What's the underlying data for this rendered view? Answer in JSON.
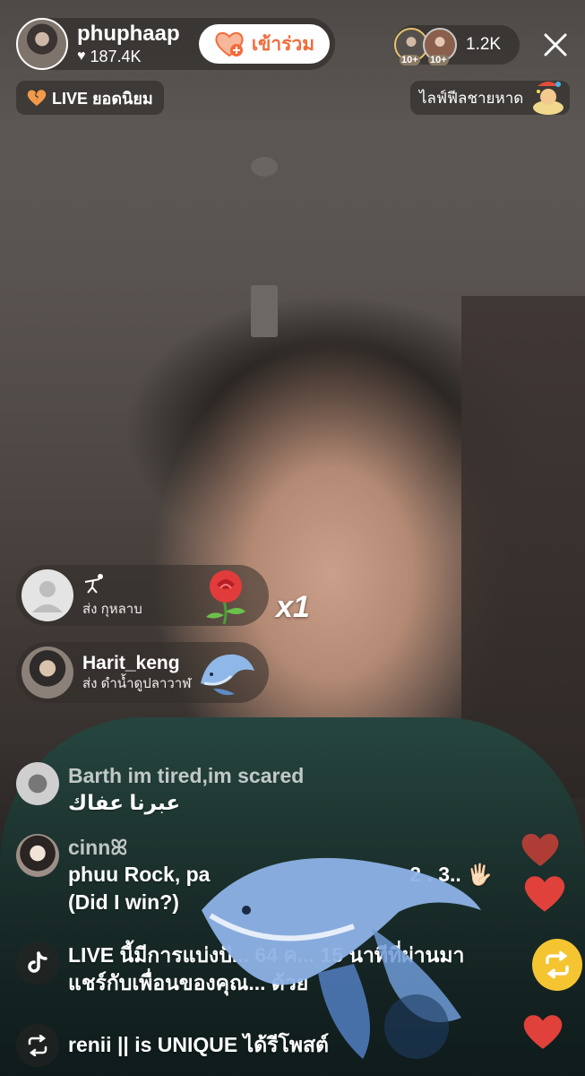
{
  "host": {
    "name": "phuphaap",
    "likes": "187.4K",
    "join_label": "เข้าร่วม"
  },
  "viewers": {
    "count": "1.2K",
    "avatar_tags": [
      "10+",
      "10+"
    ]
  },
  "badges": {
    "live_label": "LIVE ยอดนิยม",
    "event_label": "ไลฟ์ฟีลชายหาด"
  },
  "gifts": [
    {
      "user": "",
      "desc": "ส่ง กุหลาบ",
      "gift_icon": "rose-icon"
    },
    {
      "user": "Harit_keng",
      "desc": "ส่ง ดำน้ำดูปลาวาฬ",
      "gift_icon": "whale-icon"
    }
  ],
  "gift_combo": "x1",
  "comments": [
    {
      "user": "Barth im tired,im scared",
      "message": "عبرنا عفاك"
    },
    {
      "user": "cinnꕤ",
      "message_line1": "phuu Rock, pa",
      "message_line1_tail": "2 . 3.. 🖐🏻",
      "message_line2": "(Did I win?)"
    }
  ],
  "system_message": {
    "line1": "LIVE นี้มีการแบ่งปั... 64 ค... 15 นาทีที่ผ่านมา",
    "line2": "แชร์กับเพื่อนของคุณ... ด้วย"
  },
  "repost": {
    "text": "renii || is UNIQUE ได้รีโพสต์"
  },
  "colors": {
    "join_accent": "#f26b3a",
    "share_button": "#f5c431",
    "heart": "#e0413a"
  }
}
